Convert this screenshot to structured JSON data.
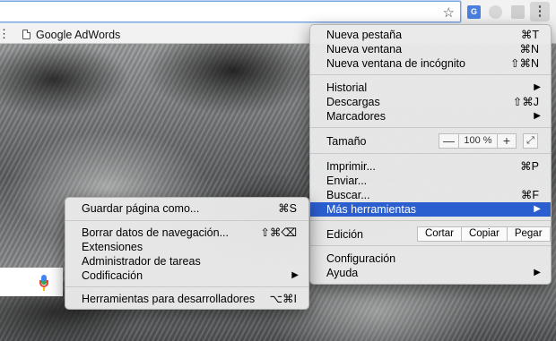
{
  "bookmarks_bar": {
    "overflow": "⋮",
    "items": [
      {
        "label": "Google AdWords",
        "icon": "page-icon"
      }
    ]
  },
  "toolbar": {
    "star_glyph": "☆",
    "translate_glyph": "G",
    "menu_glyph": "⋮"
  },
  "main_menu": {
    "new_tab": {
      "label": "Nueva pestaña",
      "shortcut": "⌘T"
    },
    "new_window": {
      "label": "Nueva ventana",
      "shortcut": "⌘N"
    },
    "incognito": {
      "label": "Nueva ventana de incógnito",
      "shortcut": "⇧⌘N"
    },
    "history": {
      "label": "Historial",
      "arrow": "▶"
    },
    "downloads": {
      "label": "Descargas",
      "shortcut": "⇧⌘J"
    },
    "bookmarks": {
      "label": "Marcadores",
      "arrow": "▶"
    },
    "zoom": {
      "label": "Tamaño",
      "minus": "—",
      "level": "100 %",
      "plus": "+",
      "fullscreen": "⤢"
    },
    "print": {
      "label": "Imprimir...",
      "shortcut": "⌘P"
    },
    "send": {
      "label": "Enviar..."
    },
    "find": {
      "label": "Buscar...",
      "shortcut": "⌘F"
    },
    "more_tools": {
      "label": "Más herramientas",
      "arrow": "▶"
    },
    "edit": {
      "label": "Edición",
      "cut": "Cortar",
      "copy": "Copiar",
      "paste": "Pegar"
    },
    "settings": {
      "label": "Configuración"
    },
    "help": {
      "label": "Ayuda",
      "arrow": "▶"
    }
  },
  "sub_menu": {
    "save_page": {
      "label": "Guardar página como...",
      "shortcut": "⌘S"
    },
    "clear_data": {
      "label": "Borrar datos de navegación...",
      "shortcut": "⇧⌘⌫"
    },
    "extensions": {
      "label": "Extensiones"
    },
    "task_manager": {
      "label": "Administrador de tareas"
    },
    "encoding": {
      "label": "Codificación",
      "arrow": "▶"
    },
    "dev_tools": {
      "label": "Herramientas para desarrolladores",
      "shortcut": "⌥⌘I"
    }
  },
  "colors": {
    "highlight": "#2b5fd0",
    "omnibox_focus": "#7aa4e0"
  }
}
